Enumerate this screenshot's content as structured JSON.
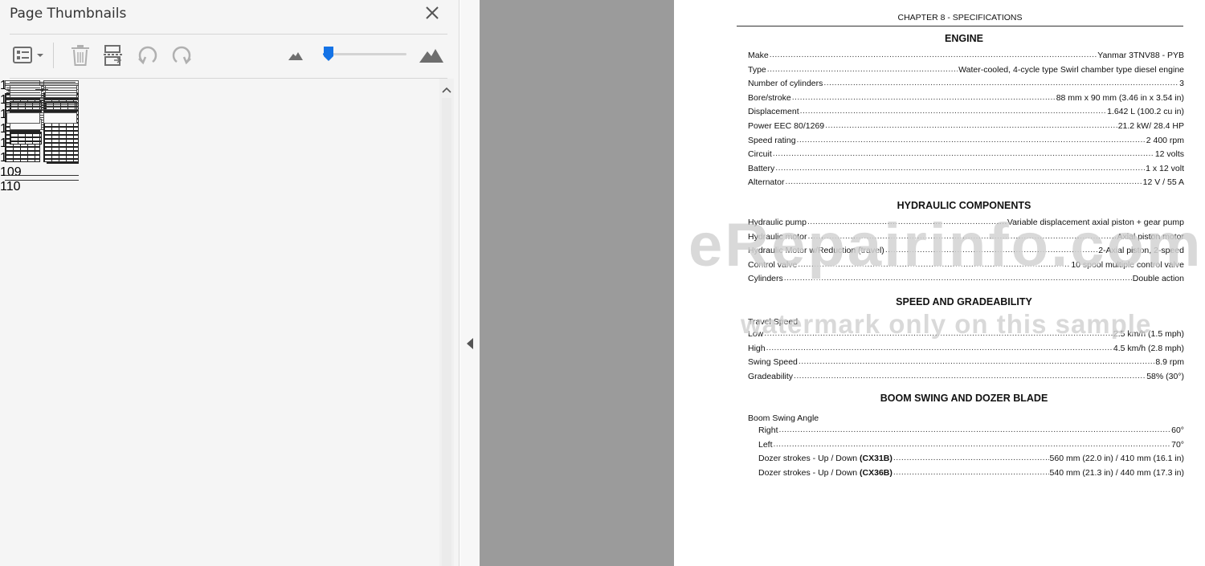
{
  "panel": {
    "title": "Page Thumbnails",
    "close_icon": "close-icon",
    "toolbar": {
      "options_icon": "thumbnail-options-icon",
      "delete_icon": "trash-icon",
      "insert_icon": "insert-pages-icon",
      "rotate_ccw_icon": "rotate-counterclockwise-icon",
      "rotate_cw_icon": "rotate-clockwise-icon",
      "zoom_out_icon": "small-mountains-icon",
      "zoom_in_icon": "large-mountains-icon",
      "zoom_level": 0.06
    },
    "thumbnails": [
      {
        "page": "103",
        "layout": "text-table"
      },
      {
        "page": "104",
        "layout": "tables"
      },
      {
        "page": "105",
        "layout": "diagrams"
      },
      {
        "page": "106",
        "layout": "blank"
      },
      {
        "page": "107",
        "layout": "toc"
      },
      {
        "page": "108",
        "layout": "title-only"
      },
      {
        "page": "109",
        "layout": "text-columns"
      },
      {
        "page": "110",
        "layout": "text-columns"
      }
    ]
  },
  "document": {
    "header": "CHAPTER 8 - SPECIFICATIONS",
    "watermark_main": "eRepairinfo.com",
    "watermark_sub": "watermark only on this sample",
    "sections": [
      {
        "title": "ENGINE",
        "rows": [
          {
            "label": "Make",
            "value": "Yanmar 3TNV88 - PYB"
          },
          {
            "label": "Type",
            "value": "Water-cooled, 4-cycle type Swirl chamber type diesel engine"
          },
          {
            "label": "Number of cylinders",
            "value": "3"
          },
          {
            "label": "Bore/stroke",
            "value": "88 mm x 90 mm (3.46 in x 3.54 in)"
          },
          {
            "label": "Displacement",
            "value": "1.642 L (100.2 cu in)"
          },
          {
            "label": "Power EEC 80/1269",
            "value": "21.2 kW/ 28.4 HP"
          },
          {
            "label": "Speed rating",
            "value": "2 400 rpm"
          },
          {
            "label": "Circuit",
            "value": "12 volts"
          },
          {
            "label": "Battery",
            "value": "1 x 12 volt"
          },
          {
            "label": "Alternator",
            "value": "12 V / 55 A"
          }
        ]
      },
      {
        "title": "HYDRAULIC COMPONENTS",
        "rows": [
          {
            "label": "Hydraulic pump",
            "value": "Variable displacement axial piston + gear pump"
          },
          {
            "label": "Hydraulic motor",
            "value": "Axial piston motor"
          },
          {
            "label": "Hydraulic Motor w/Reduction (travel)",
            "value": "2-Axial piston, 2-speed"
          },
          {
            "label": "Control valve",
            "value": "10 spool multiple control valve"
          },
          {
            "label": "Cylinders",
            "value": "Double action"
          }
        ]
      },
      {
        "title": "SPEED AND GRADEABILITY",
        "subheading": "Travel Speed",
        "rows": [
          {
            "label": "Low",
            "value": "2.5 km/h (1.5 mph)"
          },
          {
            "label": "High",
            "value": "4.5 km/h (2.8 mph)"
          },
          {
            "label": "Swing Speed",
            "value": "8.9 rpm"
          },
          {
            "label": "Gradeability",
            "value": "58% (30°)"
          }
        ]
      },
      {
        "title": "BOOM SWING AND DOZER BLADE",
        "subheading": "Boom Swing Angle",
        "rows": [
          {
            "label": "Right",
            "value": "60°"
          },
          {
            "label": "Left",
            "value": "70°"
          },
          {
            "label": "Dozer strokes - Up / Down ",
            "label_bold": "(CX31B)",
            "value": "560 mm (22.0 in) / 410 mm (16.1 in)"
          },
          {
            "label": "Dozer strokes - Up / Down ",
            "label_bold": "(CX36B)",
            "value": "540 mm (21.3 in) / 440 mm (17.3 in)"
          }
        ]
      }
    ]
  }
}
